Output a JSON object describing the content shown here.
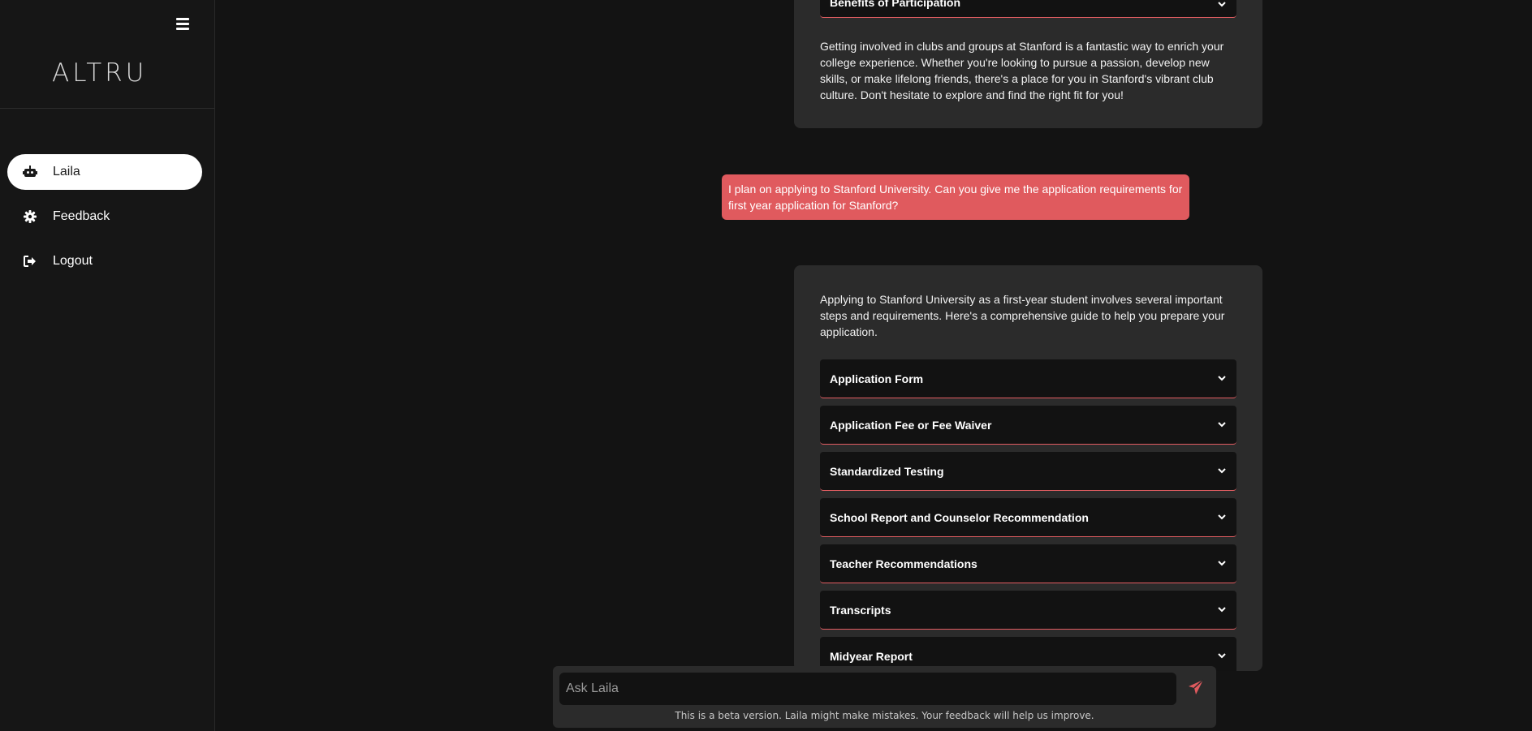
{
  "sidebar": {
    "logo": "ALTRU",
    "items": [
      {
        "label": "Laila",
        "icon": "robot-icon",
        "active": true
      },
      {
        "label": "Feedback",
        "icon": "gear-icon",
        "active": false
      },
      {
        "label": "Logout",
        "icon": "logout-icon",
        "active": false
      }
    ]
  },
  "chat": {
    "prev_bot": {
      "accordion_label": "Benefits of Participation",
      "text": "Getting involved in clubs and groups at Stanford is a fantastic way to enrich your college experience. Whether you're looking to pursue a passion, develop new skills, or make lifelong friends, there's a place for you in Stanford's vibrant club culture. Don't hesitate to explore and find the right fit for you!"
    },
    "user_message": "I plan on applying to Stanford University. Can you give me the application requirements for first year application for Stanford?",
    "bot_reply": {
      "intro": "Applying to Stanford University as a first-year student involves several important steps and requirements. Here's a comprehensive guide to help you prepare your application.",
      "sections": [
        "Application Form",
        "Application Fee or Fee Waiver",
        "Standardized Testing",
        "School Report and Counselor Recommendation",
        "Teacher Recommendations",
        "Transcripts",
        "Midyear Report"
      ]
    }
  },
  "input": {
    "placeholder": "Ask Laila",
    "disclaimer": "This is a beta version. Laila might make mistakes. Your feedback will help us improve."
  },
  "colors": {
    "accent": "#e05a5e",
    "background": "#131313",
    "card": "#2b2b2b"
  }
}
